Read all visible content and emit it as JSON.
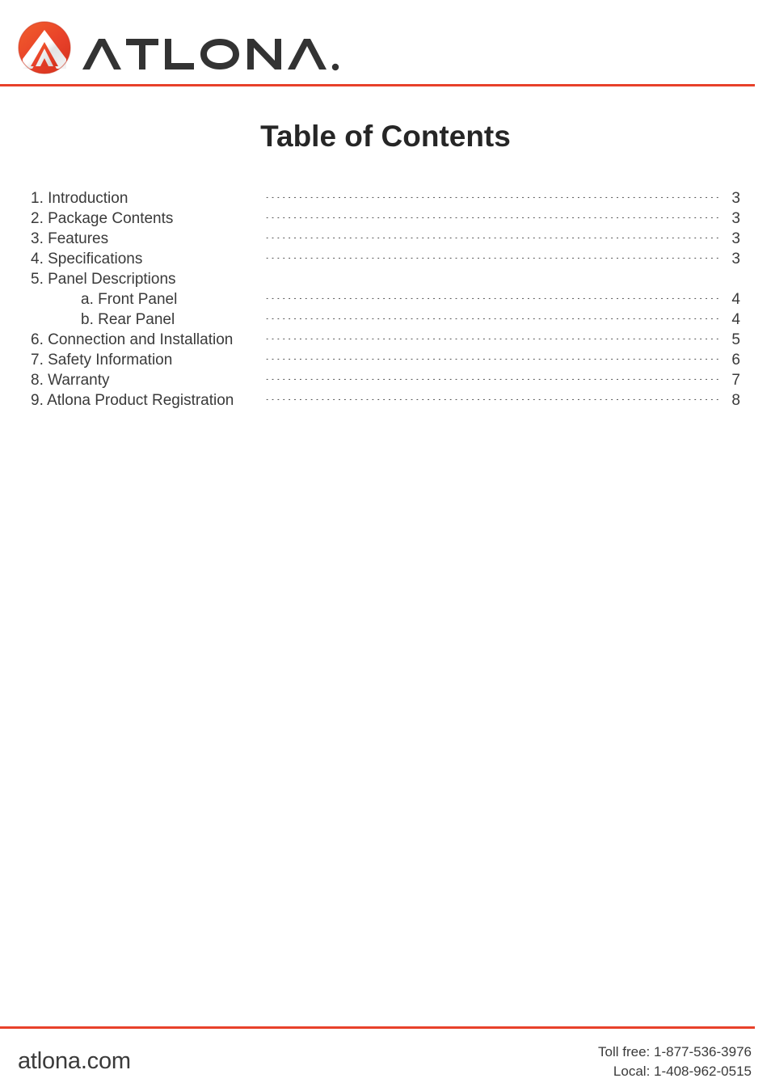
{
  "brand": {
    "logo_mark_icon": "atlona-chevron-circle-icon",
    "wordmark_text": "ATLONA",
    "wordmark_trademark": "®",
    "accent_color": "#e8412a",
    "wordmark_color": "#333333",
    "text_color": "#3a3a3a"
  },
  "header": {
    "divider_color": "#e8412a"
  },
  "title": "Table of Contents",
  "toc": {
    "leader_dots": "..........................................................................................................................................",
    "entries": [
      {
        "label": "1. Introduction",
        "page": "3",
        "sub": false
      },
      {
        "label": "2. Package Contents",
        "page": "3",
        "sub": false
      },
      {
        "label": "3. Features",
        "page": "3",
        "sub": false
      },
      {
        "label": "4. Specifications",
        "page": "3",
        "sub": false
      },
      {
        "label": "5. Panel Descriptions",
        "page": "",
        "sub": false
      },
      {
        "label": "a. Front Panel",
        "page": "4",
        "sub": true
      },
      {
        "label": "b. Rear Panel",
        "page": "4",
        "sub": true
      },
      {
        "label": "6. Connection and Installation",
        "page": "5",
        "sub": false
      },
      {
        "label": "7. Safety Information",
        "page": "6",
        "sub": false
      },
      {
        "label": "8. Warranty",
        "page": "7",
        "sub": false
      },
      {
        "label": "9. Atlona Product Registration",
        "page": "8",
        "sub": false
      }
    ]
  },
  "footer": {
    "site": "atlona.com",
    "toll_free": "Toll free: 1-877-536-3976",
    "local": "Local: 1-408-962-0515",
    "divider_color": "#e8412a"
  }
}
